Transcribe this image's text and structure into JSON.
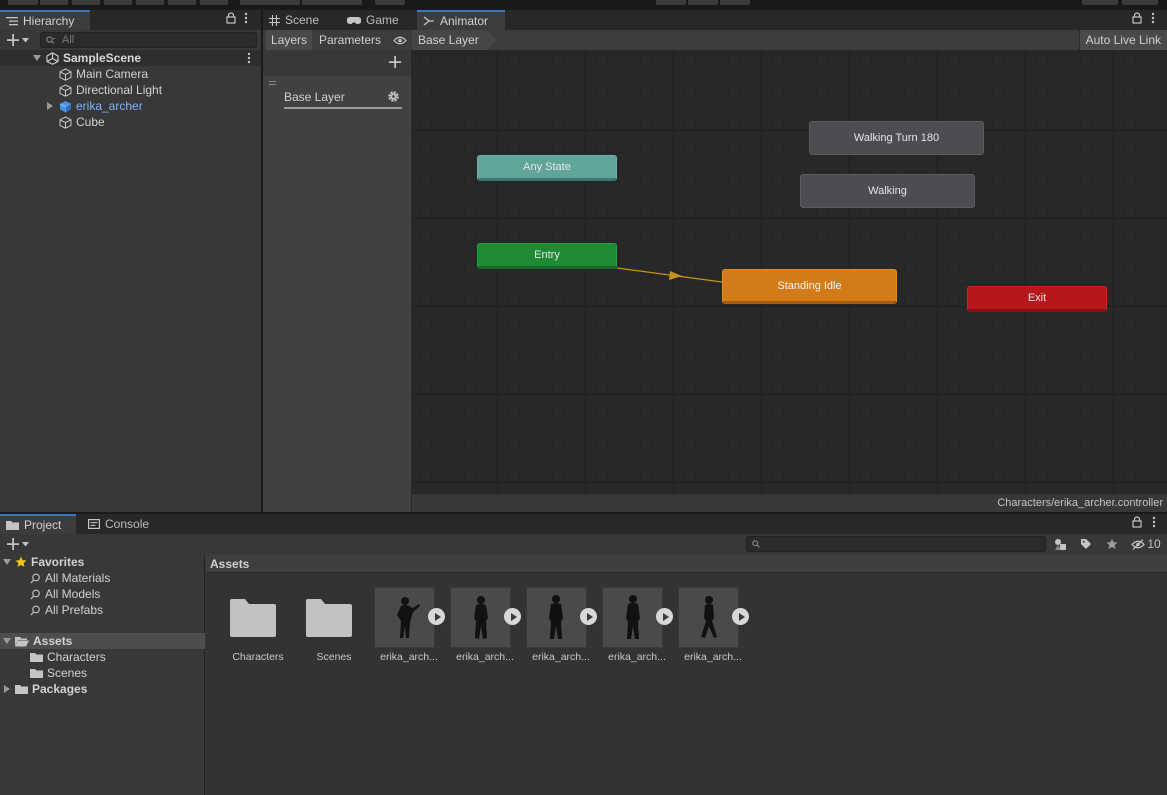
{
  "hierarchy": {
    "tab_label": "Hierarchy",
    "search_placeholder": "All",
    "scene_name": "SampleScene",
    "items": [
      {
        "label": "Main Camera"
      },
      {
        "label": "Directional Light"
      },
      {
        "label": "erika_archer"
      },
      {
        "label": "Cube"
      }
    ]
  },
  "center_tabs": {
    "scene": "Scene",
    "game": "Game",
    "animator": "Animator"
  },
  "animator": {
    "subtabs": {
      "layers": "Layers",
      "parameters": "Parameters"
    },
    "breadcrumb": "Base Layer",
    "auto_live_link": "Auto Live Link",
    "layer_name": "Base Layer",
    "status_path": "Characters/erika_archer.controller",
    "states": {
      "any_state": "Any State",
      "entry": "Entry",
      "standing_idle": "Standing Idle",
      "walking": "Walking",
      "walking_turn": "Walking Turn 180",
      "exit": "Exit"
    }
  },
  "project": {
    "tabs": {
      "project": "Project",
      "console": "Console"
    },
    "hidden_count": "10",
    "favorites": {
      "label": "Favorites",
      "items": [
        "All Materials",
        "All Models",
        "All Prefabs"
      ]
    },
    "assets": {
      "label": "Assets",
      "items": [
        "Characters",
        "Scenes"
      ]
    },
    "packages_label": "Packages",
    "assets_header": "Assets",
    "grid": [
      {
        "label": "Characters",
        "kind": "folder"
      },
      {
        "label": "Scenes",
        "kind": "folder"
      },
      {
        "label": "erika_arch...",
        "kind": "anim"
      },
      {
        "label": "erika_arch...",
        "kind": "anim"
      },
      {
        "label": "erika_arch...",
        "kind": "anim"
      },
      {
        "label": "erika_arch...",
        "kind": "anim"
      },
      {
        "label": "erika_arch...",
        "kind": "anim"
      }
    ]
  },
  "colors": {
    "accent_blue": "#3a79bb",
    "selected_object": "#7fb2ff",
    "any_state": "#5fa59a",
    "entry": "#1e8a33",
    "default_state": "#d37b18",
    "exit": "#b5171b",
    "transition": "#c7931a"
  }
}
